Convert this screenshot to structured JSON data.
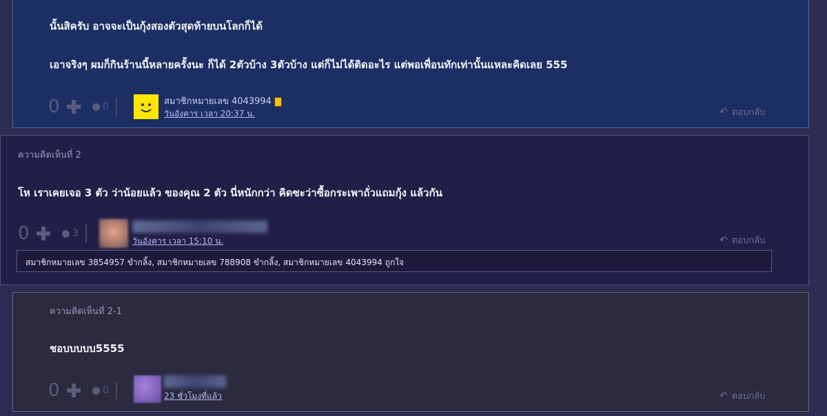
{
  "comment_top": {
    "line1": "นั้นสิครับ อาจจะเป็นกุ้งสองตัวสุดท้ายบนโลกก็ได้",
    "line2": "เอาจริงๆ ผมก็กินร้านนี้หลายครั้งนะ ก็ได้ 2ตัวบ้าง 3ตัวบ้าง แต่ก็ไม่ได้ติดอะไร แต่พอเพื่อนทักเท่านั้นแหละคิดเลย 555",
    "votes": "0",
    "emotions": "0",
    "author": "สมาชิกหมายเลข 4043994",
    "date": "วันอังคาร เวลา 20:37 น.",
    "reply_label": "ตอบกลับ"
  },
  "comment_2": {
    "label": "ความคิดเห็นที่ 2",
    "text": "โห เราเคยเจอ 3 ตัว ว่าน้อยแล้ว ของคุณ 2 ตัว นี่หนักกว่า คิดซะว่าซื้อกระเพาถั่วแถมกุ้ง แล้วกัน",
    "votes": "0",
    "emotions": "3",
    "date": "วันอังคาร เวลา 15:10 น.",
    "reply_label": "ตอบกลับ",
    "likes": "สมาชิกหมายเลข 3854957 ขำกลิ้ง, สมาชิกหมายเลข 788908 ขำกลิ้ง, สมาชิกหมายเลข 4043994 ถูกใจ"
  },
  "comment_2_1": {
    "label": "ความคิดเห็นที่ 2-1",
    "text": "ชอบบบบบ5555",
    "votes": "0",
    "emotions": "0",
    "date": "23 ชั่วโมงที่แล้ว",
    "reply_label": "ตอบกลับ"
  },
  "colors": {
    "page_bg": "#2f2c52",
    "top_panel_bg": "#1c2f64",
    "comment_bg": "#221f47",
    "reply_bg": "#2b2a3f",
    "link": "#b6bdf2"
  },
  "icons": [
    "plus-icon",
    "emotion-icon",
    "smiley-avatar",
    "reply-arrow-icon",
    "member-badge-icon"
  ]
}
